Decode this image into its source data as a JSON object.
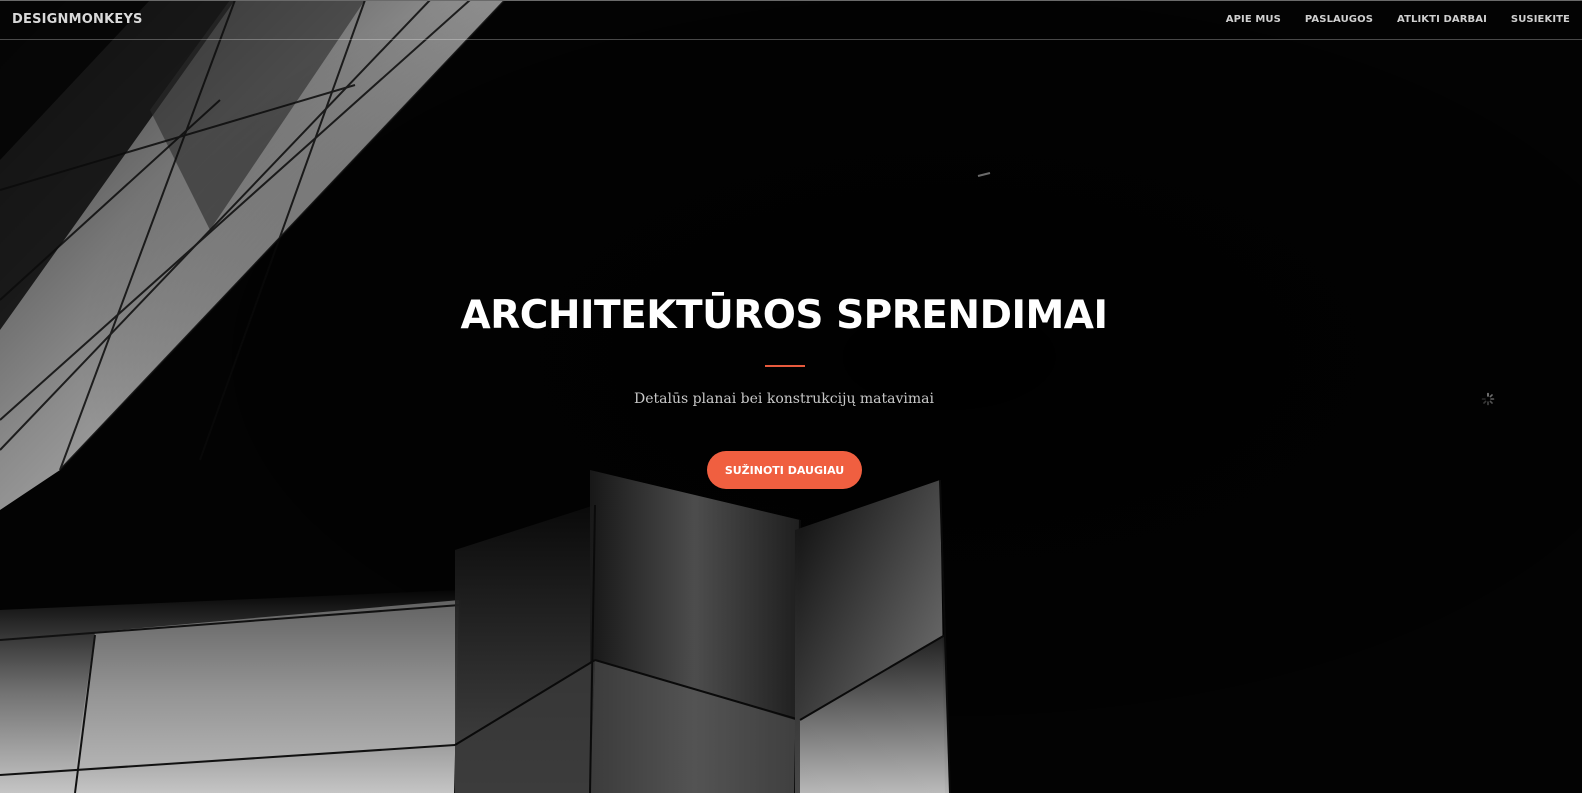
{
  "navbar": {
    "brand": "DESIGNMONKEYS",
    "links": [
      "APIE MUS",
      "PASLAUGOS",
      "ATLIKTI DARBAI",
      "SUSIEKITE"
    ]
  },
  "hero": {
    "title": "ARCHITEKTŪROS SPRENDIMAI",
    "subtitle": "Detalūs planai bei konstrukcijų matavimai",
    "button_label": "SUŽINOTI DAUGIAU"
  },
  "colors": {
    "accent": "#f05f40",
    "background": "#000000",
    "text": "#ffffff"
  },
  "icons": {
    "loading": "spinner-icon"
  }
}
